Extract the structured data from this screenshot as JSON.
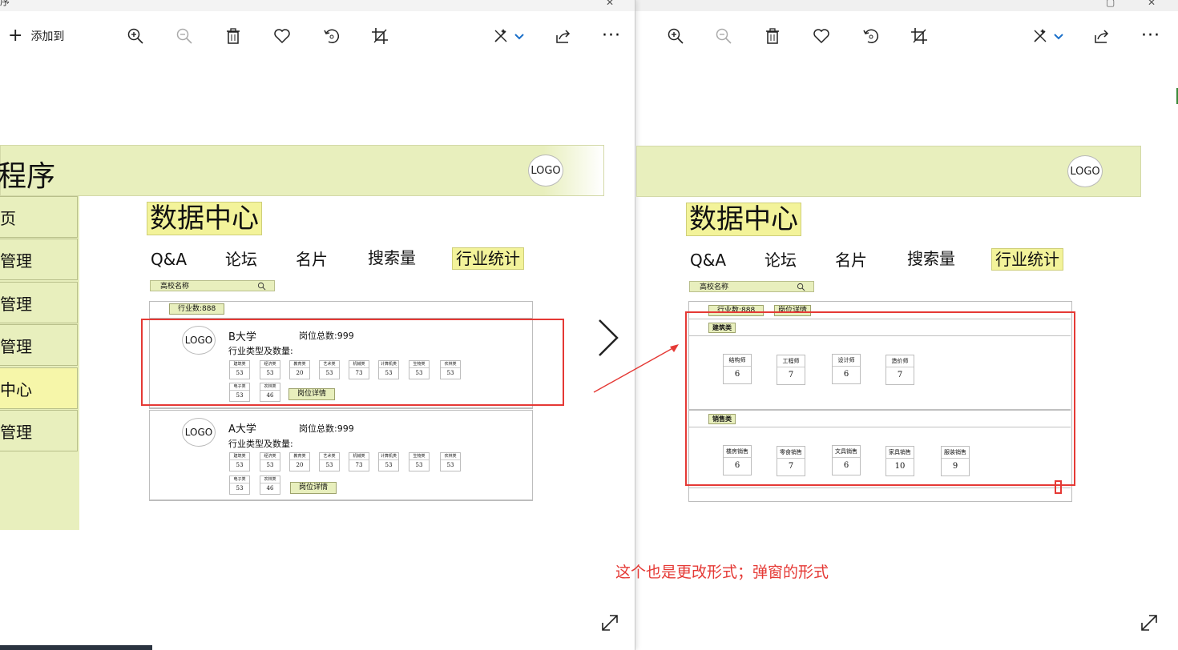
{
  "left_window": {
    "title_chars": "序",
    "toolbar": {
      "add_to_label": "添加到",
      "more_label": "···"
    },
    "mockup": {
      "app_title": "程序",
      "logo": "LOGO",
      "sidebar": [
        {
          "label": "页",
          "active": false
        },
        {
          "label": "管理",
          "active": false
        },
        {
          "label": "管理",
          "active": false
        },
        {
          "label": "管理",
          "active": false
        },
        {
          "label": "中心",
          "active": true
        },
        {
          "label": "管理",
          "active": false
        }
      ],
      "page_title": "数据中心",
      "tabs": [
        {
          "label": "Q&A",
          "active": false
        },
        {
          "label": "论坛",
          "active": false
        },
        {
          "label": "名片",
          "active": false
        },
        {
          "label": "搜索量",
          "active": false
        },
        {
          "label": "行业统计",
          "active": true
        }
      ],
      "search_placeholder": "高校名称",
      "industry_count": "行业数:888",
      "universities": [
        {
          "logo": "LOGO",
          "name": "B大学",
          "total": "岗位总数:999",
          "subtitle": "行业类型及数量:",
          "industries": [
            {
              "label": "建筑类",
              "value": "53"
            },
            {
              "label": "经济类",
              "value": "53"
            },
            {
              "label": "教育类",
              "value": "20"
            },
            {
              "label": "艺术类",
              "value": "53"
            },
            {
              "label": "机械类",
              "value": "73"
            },
            {
              "label": "计算机类",
              "value": "53"
            },
            {
              "label": "生物类",
              "value": "53"
            },
            {
              "label": "农林类",
              "value": "53"
            },
            {
              "label": "电子类",
              "value": "53"
            },
            {
              "label": "农林类",
              "value": "46"
            }
          ],
          "detail_button": "岗位详情"
        },
        {
          "logo": "LOGO",
          "name": "A大学",
          "total": "岗位总数:999",
          "subtitle": "行业类型及数量:",
          "industries": [
            {
              "label": "建筑类",
              "value": "53"
            },
            {
              "label": "经济类",
              "value": "53"
            },
            {
              "label": "教育类",
              "value": "20"
            },
            {
              "label": "艺术类",
              "value": "53"
            },
            {
              "label": "机械类",
              "value": "73"
            },
            {
              "label": "计算机类",
              "value": "53"
            },
            {
              "label": "生物类",
              "value": "53"
            },
            {
              "label": "农林类",
              "value": "53"
            },
            {
              "label": "电子类",
              "value": "53"
            },
            {
              "label": "农林类",
              "value": "46"
            }
          ],
          "detail_button": "岗位详情"
        }
      ]
    }
  },
  "right_window": {
    "toolbar": {
      "more_label": "···"
    },
    "mockup": {
      "logo": "LOGO",
      "page_title": "数据中心",
      "tabs": [
        {
          "label": "Q&A",
          "active": false
        },
        {
          "label": "论坛",
          "active": false
        },
        {
          "label": "名片",
          "active": false
        },
        {
          "label": "搜索量",
          "active": false
        },
        {
          "label": "行业统计",
          "active": true
        }
      ],
      "search_placeholder": "高校名称",
      "industry_count": "行业数:888",
      "detail_tag": "岗位详情",
      "popup_sections": [
        {
          "title": "建筑类",
          "jobs": [
            {
              "label": "结构师",
              "value": "6"
            },
            {
              "label": "工程师",
              "value": "7"
            },
            {
              "label": "设计师",
              "value": "6"
            },
            {
              "label": "造价师",
              "value": "7"
            }
          ]
        },
        {
          "title": "销售类",
          "jobs": [
            {
              "label": "楼房销售",
              "value": "6"
            },
            {
              "label": "零食销售",
              "value": "7"
            },
            {
              "label": "文具销售",
              "value": "6"
            },
            {
              "label": "家具销售",
              "value": "10"
            },
            {
              "label": "服装销售",
              "value": "9"
            }
          ]
        }
      ]
    }
  },
  "annotation": "这个也是更改形式；弹窗的形式",
  "colors": {
    "highlight_red": "#e53935",
    "mockup_green": "#e8efbd",
    "active_yellow": "#f3f39a"
  },
  "icons": [
    "plus-icon",
    "zoom-in-icon",
    "zoom-out-icon",
    "trash-icon",
    "heart-icon",
    "rotate-icon",
    "crop-icon",
    "edit-icon",
    "chevron-down-icon",
    "share-icon",
    "more-icon",
    "next-chevron-icon",
    "expand-icon",
    "search-icon"
  ]
}
